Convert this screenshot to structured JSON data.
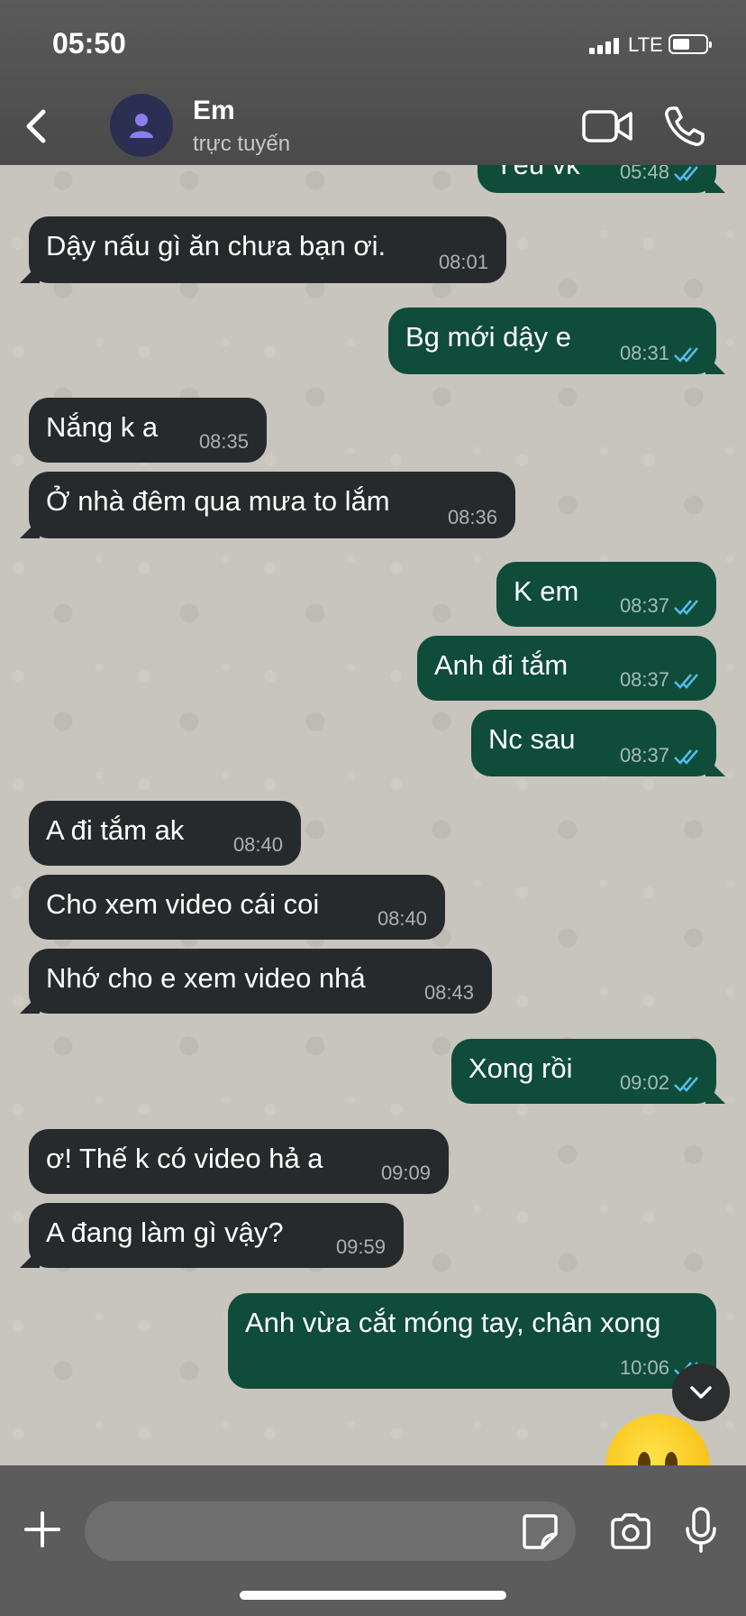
{
  "status_bar": {
    "time": "05:50",
    "network": "LTE"
  },
  "header": {
    "contact_name": "Em",
    "contact_status": "trực tuyến"
  },
  "messages": [
    {
      "dir": "out",
      "text": "Yêu vk",
      "time": "05:48"
    },
    {
      "dir": "in",
      "text": "Dậy nấu gì ăn chưa bạn ơi.",
      "time": "08:01"
    },
    {
      "dir": "out",
      "text": "Bg mới dậy e",
      "time": "08:31"
    },
    {
      "dir": "in",
      "text": "Nắng k a",
      "time": "08:35"
    },
    {
      "dir": "in",
      "text": "Ở nhà đêm qua mưa to lắm",
      "time": "08:36"
    },
    {
      "dir": "out",
      "text": "K em",
      "time": "08:37"
    },
    {
      "dir": "out",
      "text": "Anh đi tắm",
      "time": "08:37"
    },
    {
      "dir": "out",
      "text": "Nc sau",
      "time": "08:37"
    },
    {
      "dir": "in",
      "text": "A đi tắm ak",
      "time": "08:40"
    },
    {
      "dir": "in",
      "text": "Cho xem video cái coi",
      "time": "08:40"
    },
    {
      "dir": "in",
      "text": "Nhớ cho e xem video nhá",
      "time": "08:43"
    },
    {
      "dir": "out",
      "text": "Xong rồi",
      "time": "09:02"
    },
    {
      "dir": "in",
      "text": "ơ! Thế k có video hả a",
      "time": "09:09"
    },
    {
      "dir": "in",
      "text": "A đang làm gì vậy?",
      "time": "09:59"
    },
    {
      "dir": "out",
      "text": "Anh vừa cắt móng tay, chân xong",
      "time": "10:06"
    }
  ],
  "composer": {
    "placeholder": "",
    "value": ""
  },
  "icons": {
    "back": "chevron-left-icon",
    "avatar": "person-icon",
    "video": "video-camera-icon",
    "call": "phone-icon",
    "plus": "plus-icon",
    "sticker": "sticker-icon",
    "camera": "camera-icon",
    "mic": "microphone-icon",
    "scroll": "chevron-down-icon",
    "read": "double-check-icon"
  },
  "colors": {
    "incoming": "#272a2c",
    "outgoing": "#0f4c3a",
    "read_ticks": "#53bdeb",
    "header": "#4f4f4f"
  }
}
